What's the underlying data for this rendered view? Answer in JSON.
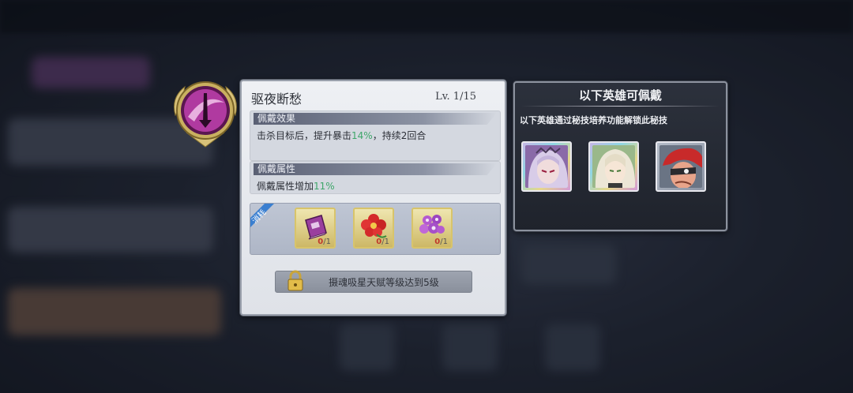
{
  "skill": {
    "name": "驱夜断愁",
    "level": "Lv.  1/15",
    "effect_title": "佩戴效果",
    "effect_prefix": "击杀目标后，提升暴击",
    "effect_value": "14%",
    "effect_suffix": "，持续2回合",
    "attr_title": "佩戴属性",
    "attr_prefix": "佩戴属性增加",
    "attr_value": "11%"
  },
  "cost": {
    "ribbon_label": "消耗",
    "items": [
      {
        "icon": "purple-book-icon",
        "owned": "0",
        "need": "/1"
      },
      {
        "icon": "red-flower-icon",
        "owned": "0",
        "need": "/1"
      },
      {
        "icon": "purple-flower-icon",
        "owned": "0",
        "need": "/1"
      }
    ]
  },
  "unlock": {
    "icon": "lock-icon",
    "text": "摄魂吸星天赋等级达到5级"
  },
  "heroes_panel": {
    "title": "以下英雄可佩戴",
    "subtitle": "以下英雄通过秘技培养功能解锁此秘技",
    "heroes": [
      {
        "icon": "hero-portrait-silver-hair"
      },
      {
        "icon": "hero-portrait-white-hair"
      },
      {
        "icon": "hero-portrait-red-hood"
      }
    ]
  },
  "colors": {
    "highlight": "#3ea66a",
    "count_red": "#c0392b",
    "emblem_purple": "#b03aa0"
  }
}
